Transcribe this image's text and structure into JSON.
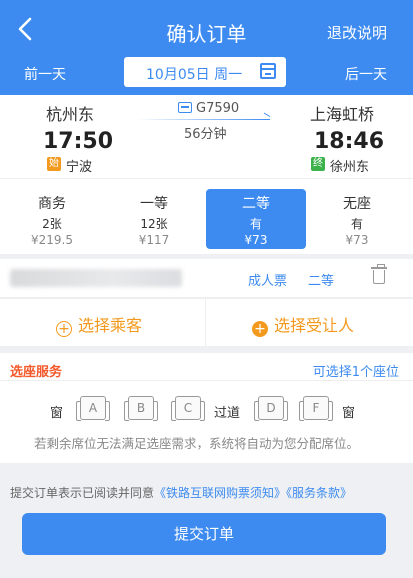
{
  "header": {
    "title": "确认订单",
    "refund_link": "退改说明",
    "prev_day": "前一天",
    "next_day": "后一天",
    "date": "10月05日 周一"
  },
  "train": {
    "from_station": "杭州东",
    "to_station": "上海虹桥",
    "depart_time": "17:50",
    "arrive_time": "18:46",
    "train_number": "G7590",
    "duration": "56分钟",
    "origin_badge": "始",
    "origin_city": "宁波",
    "terminal_badge": "终",
    "terminal_city": "徐州东"
  },
  "seat_classes": [
    {
      "name": "商务",
      "count": "2张",
      "price": "¥219.5"
    },
    {
      "name": "一等",
      "count": "12张",
      "price": "¥117"
    },
    {
      "name": "二等",
      "count": "有",
      "price": "¥73"
    },
    {
      "name": "无座",
      "count": "有",
      "price": "¥73"
    }
  ],
  "passenger": {
    "ticket_type": "成人票",
    "seat_type": "二等"
  },
  "actions": {
    "choose_passenger": "选择乘客",
    "choose_beneficiary": "选择受让人"
  },
  "seat_service": {
    "title": "选座服务",
    "limit": "可选择1个座位",
    "window_left": "窗",
    "aisle": "过道",
    "window_right": "窗",
    "seats": [
      "A",
      "B",
      "C",
      "D",
      "F"
    ],
    "note": "若剩余席位无法满足选座需求，系统将自动为您分配席位。"
  },
  "agreement": {
    "prefix": "提交订单表示已阅读并同意",
    "link1": "《铁路互联网购票须知》",
    "link2": "《服务条款》"
  },
  "submit_label": "提交订单",
  "colors": {
    "primary": "#3d8bf0",
    "accent_orange": "#f39a1e",
    "service_red": "#f35a2c",
    "terminal_green": "#3cb24a"
  }
}
